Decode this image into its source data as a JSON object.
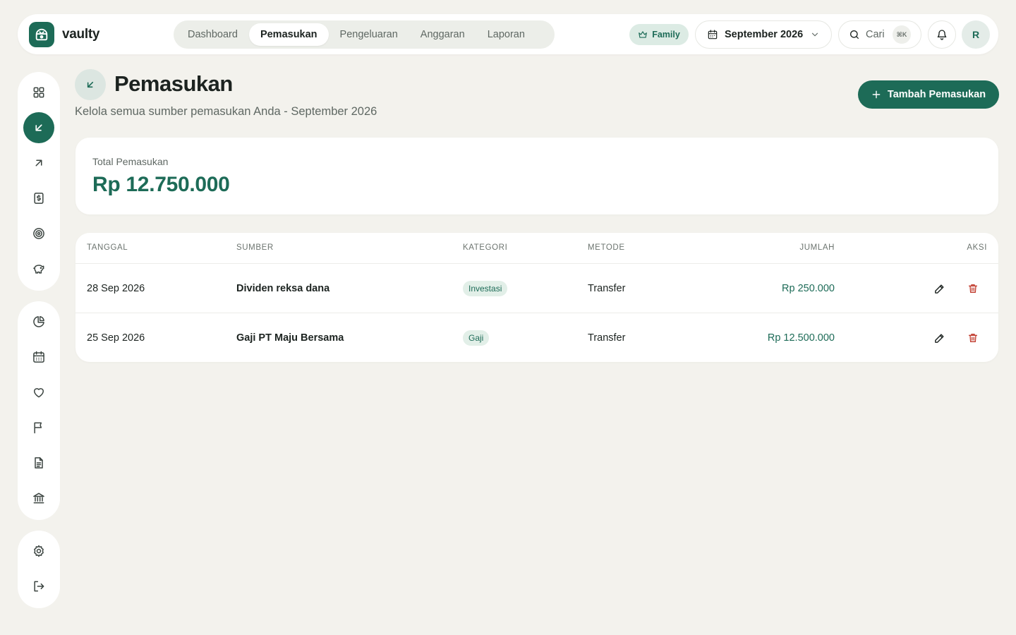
{
  "app": {
    "name": "vaulty"
  },
  "nav": {
    "tabs": [
      {
        "label": "Dashboard",
        "active": false
      },
      {
        "label": "Pemasukan",
        "active": true
      },
      {
        "label": "Pengeluaran",
        "active": false
      },
      {
        "label": "Anggaran",
        "active": false
      },
      {
        "label": "Laporan",
        "active": false
      }
    ],
    "plan_badge": "Family",
    "period": "September 2026",
    "search": {
      "label": "Cari",
      "shortcut": "⌘K"
    },
    "avatar_initial": "R"
  },
  "sidebar": {
    "group1": [
      "grid-icon",
      "arrow-down-left-icon",
      "arrow-up-right-icon",
      "bill-icon",
      "target-icon",
      "piggy-bank-icon"
    ],
    "group2": [
      "pie-chart-icon",
      "calendar-icon",
      "heart-icon",
      "flag-icon",
      "document-icon",
      "bank-icon"
    ],
    "group3": [
      "settings-icon",
      "logout-icon"
    ],
    "active": "arrow-down-left-icon"
  },
  "page": {
    "title": "Pemasukan",
    "subtitle": "Kelola semua sumber pemasukan Anda - September 2026",
    "add_button": "Tambah Pemasukan"
  },
  "summary": {
    "label": "Total Pemasukan",
    "value": "Rp 12.750.000"
  },
  "table": {
    "headers": {
      "date": "TANGGAL",
      "source": "SUMBER",
      "category": "KATEGORI",
      "method": "METODE",
      "amount": "JUMLAH",
      "actions": "AKSI"
    },
    "rows": [
      {
        "date": "28 Sep 2026",
        "source": "Dividen reksa dana",
        "category": "Investasi",
        "method": "Transfer",
        "amount": "Rp 250.000"
      },
      {
        "date": "25 Sep 2026",
        "source": "Gaji PT Maju Bersama",
        "category": "Gaji",
        "method": "Transfer",
        "amount": "Rp 12.500.000"
      }
    ]
  },
  "colors": {
    "brand": "#1d6b57",
    "background": "#f3f2ed",
    "danger": "#c0392b"
  }
}
